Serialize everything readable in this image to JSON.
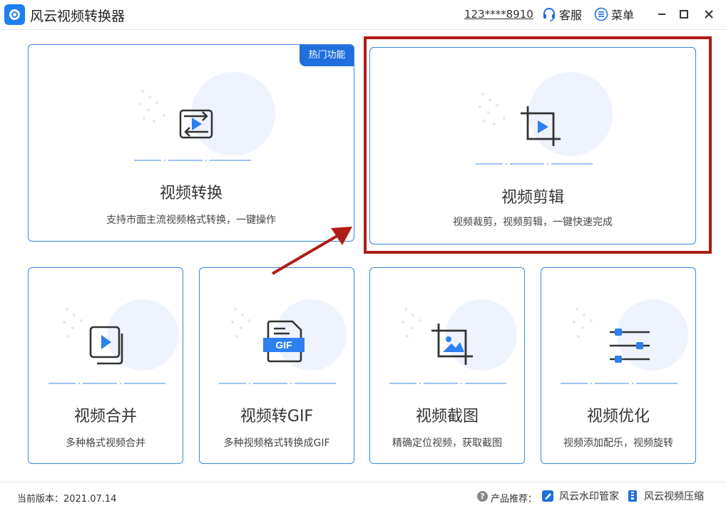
{
  "app": {
    "title": "风云视频转换器"
  },
  "header": {
    "account": "123****8910",
    "service_label": "客服",
    "menu_label": "菜单"
  },
  "cards": {
    "convert": {
      "title": "视频转换",
      "desc": "支持市面主流视频格式转换，一键操作",
      "badge": "热门功能"
    },
    "edit": {
      "title": "视频剪辑",
      "desc": "视频裁剪，视频剪辑，一键快速完成"
    },
    "merge": {
      "title": "视频合并",
      "desc": "多种格式视频合并"
    },
    "gif": {
      "title": "视频转GIF",
      "desc": "多种视频格式转换成GIF",
      "icon_text": "GIF"
    },
    "screenshot": {
      "title": "视频截图",
      "desc": "精确定位视频，获取截图"
    },
    "optimize": {
      "title": "视频优化",
      "desc": "视频添加配乐，视频旋转"
    }
  },
  "footer": {
    "version": "当前版本：2021.07.14",
    "recommend_label": "产品推荐：",
    "recommend_items": [
      "风云水印管家",
      "风云视频压缩"
    ]
  },
  "colors": {
    "accent": "#1f6fdc",
    "border": "#3a86e0",
    "highlight": "#b01c17"
  }
}
